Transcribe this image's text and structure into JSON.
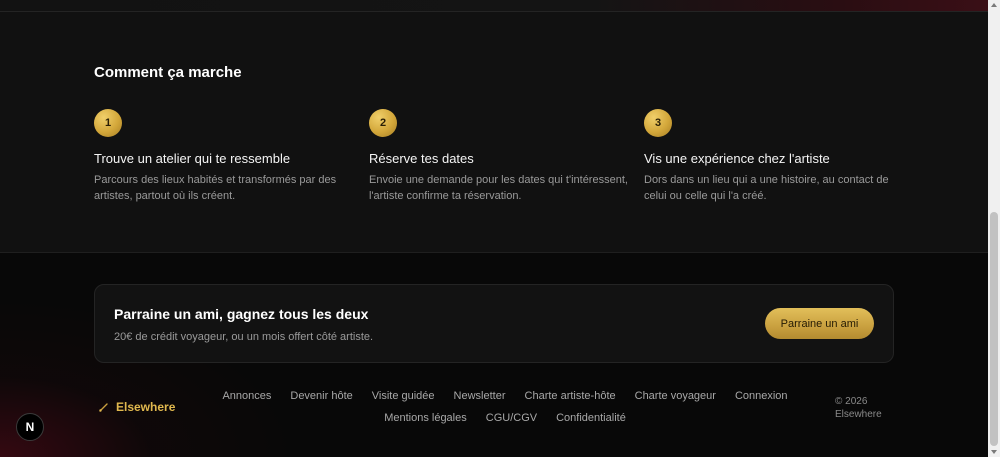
{
  "how_it_works": {
    "title": "Comment ça marche",
    "steps": [
      {
        "number": "1",
        "title": "Trouve un atelier qui te ressemble",
        "description": "Parcours des lieux habités et transformés par des artistes, partout où ils créent."
      },
      {
        "number": "2",
        "title": "Réserve tes dates",
        "description": "Envoie une demande pour les dates qui t'intéressent, l'artiste confirme ta réservation."
      },
      {
        "number": "3",
        "title": "Vis une expérience chez l'artiste",
        "description": "Dors dans un lieu qui a une histoire, au contact de celui ou celle qui l'a créé."
      }
    ]
  },
  "referral": {
    "title": "Parraine un ami, gagnez tous les deux",
    "subtitle": "20€ de crédit voyageur, ou un mois offert côté artiste.",
    "button_label": "Parraine un ami"
  },
  "footer": {
    "brand": "Elsewhere",
    "links": [
      "Annonces",
      "Devenir hôte",
      "Visite guidée",
      "Newsletter",
      "Charte artiste-hôte",
      "Charte voyageur",
      "Connexion",
      "Mentions légales",
      "CGU/CGV",
      "Confidentialité"
    ],
    "copyright_line1": "© 2026",
    "copyright_line2": "Elsewhere"
  },
  "dev_badge": "N",
  "colors": {
    "accent_gold": "#d3a73a",
    "background": "#0a0a0a",
    "section_bg": "#111111"
  }
}
